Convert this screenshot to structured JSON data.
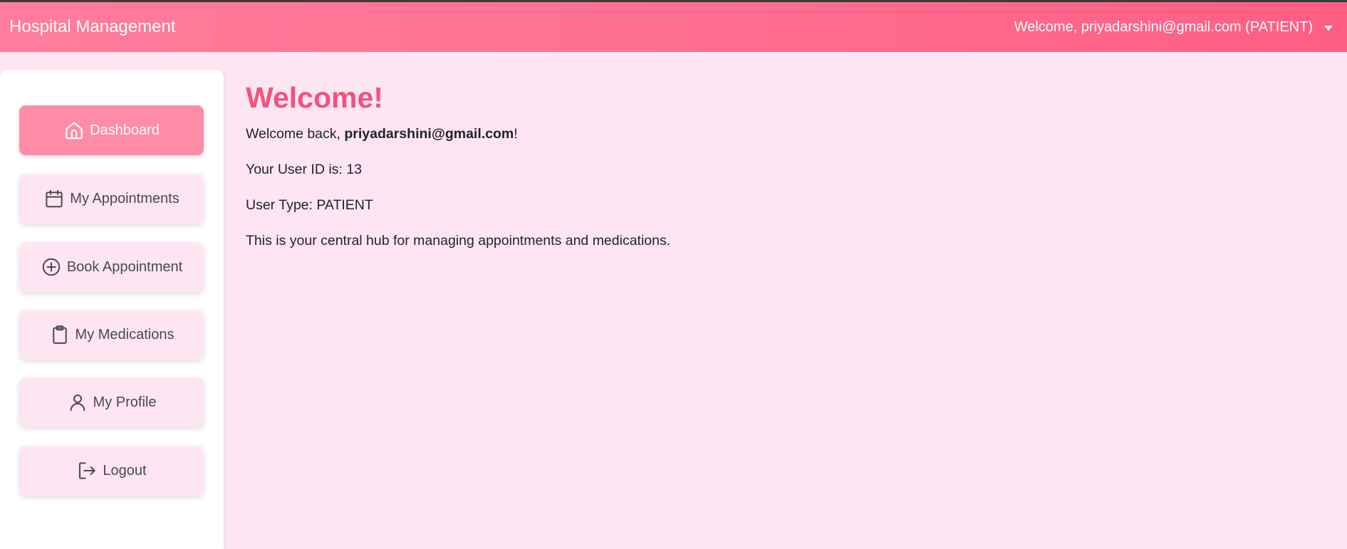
{
  "header": {
    "brand": "Hospital Management",
    "user_menu_label": "Welcome, priyadarshini@gmail.com (PATIENT)"
  },
  "sidebar": {
    "items": [
      {
        "label": "Dashboard",
        "icon": "home-icon",
        "active": true
      },
      {
        "label": "My Appointments",
        "icon": "calendar-icon"
      },
      {
        "label": "Book Appointment",
        "icon": "plus-circle-icon"
      },
      {
        "label": "My Medications",
        "icon": "clipboard-icon"
      },
      {
        "label": "My Profile",
        "icon": "user-icon"
      },
      {
        "label": "Logout",
        "icon": "logout-icon"
      }
    ]
  },
  "main": {
    "title": "Welcome!",
    "welcome_prefix": "Welcome back, ",
    "email": "priyadarshini@gmail.com",
    "welcome_suffix": "!",
    "user_id_line": "Your User ID is: 13",
    "user_type_line": "User Type: PATIENT",
    "hub_line": "This is your central hub for managing appointments and medications."
  },
  "colors": {
    "navbar_gradient_start": "#ff7d9c",
    "navbar_gradient_end": "#ff5e84",
    "page_background": "#fde6f1",
    "active_button": "#ff8ca6",
    "title_pink": "#f2527f"
  }
}
